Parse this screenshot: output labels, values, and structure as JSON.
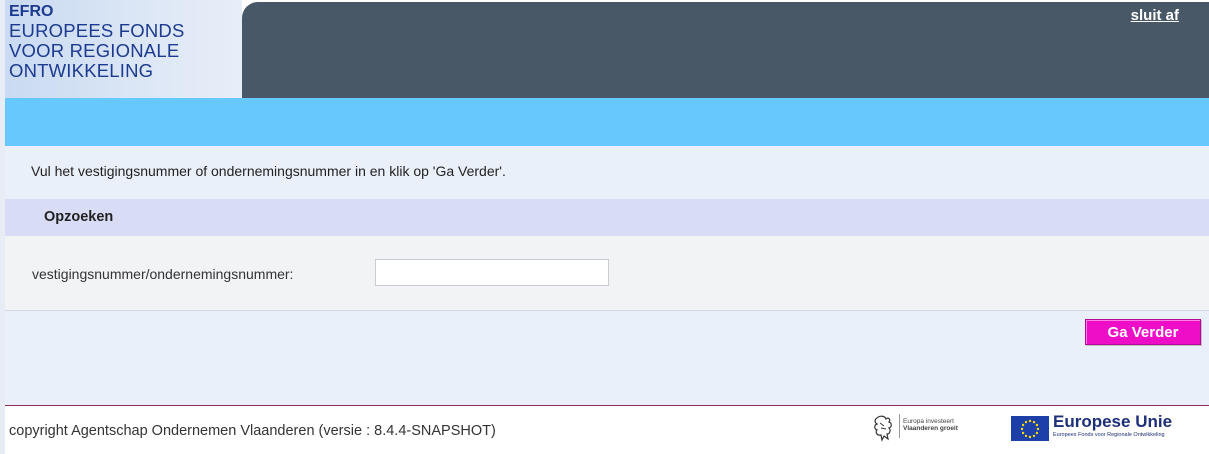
{
  "header": {
    "logo": {
      "abbr": "EFRO",
      "lines": [
        "EUROPEES FONDS",
        "VOOR REGIONALE",
        "ONTWIKKELING"
      ]
    },
    "close_link": "sluit af"
  },
  "instruction": "Vul het vestigingsnummer of ondernemingsnummer in en klik op 'Ga Verder'.",
  "section": {
    "title": "Opzoeken",
    "field_label": "vestigingsnummer/ondernemingsnummer:",
    "field_value": "",
    "field_placeholder": ""
  },
  "actions": {
    "go_button": "Ga Verder"
  },
  "footer": {
    "copyright": "copyright Agentschap Ondernemen Vlaanderen (versie : 8.4.4-SNAPSHOT)",
    "flemish_logo_lines": [
      "Europa investeert",
      "Vlaanderen groeit"
    ],
    "eu_title": "Europese Unie",
    "eu_subtitle": "Europees Fonds voor Regionale Ontwikkeling"
  },
  "icons": {
    "flemish": "lion-icon",
    "eu": "eu-flag-icon"
  },
  "colors": {
    "topbar": "#485866",
    "lightbar": "#66c8fc",
    "section_header": "#d8dcf5",
    "button": "#ee0ec8",
    "logo_text": "#1c3a90"
  }
}
